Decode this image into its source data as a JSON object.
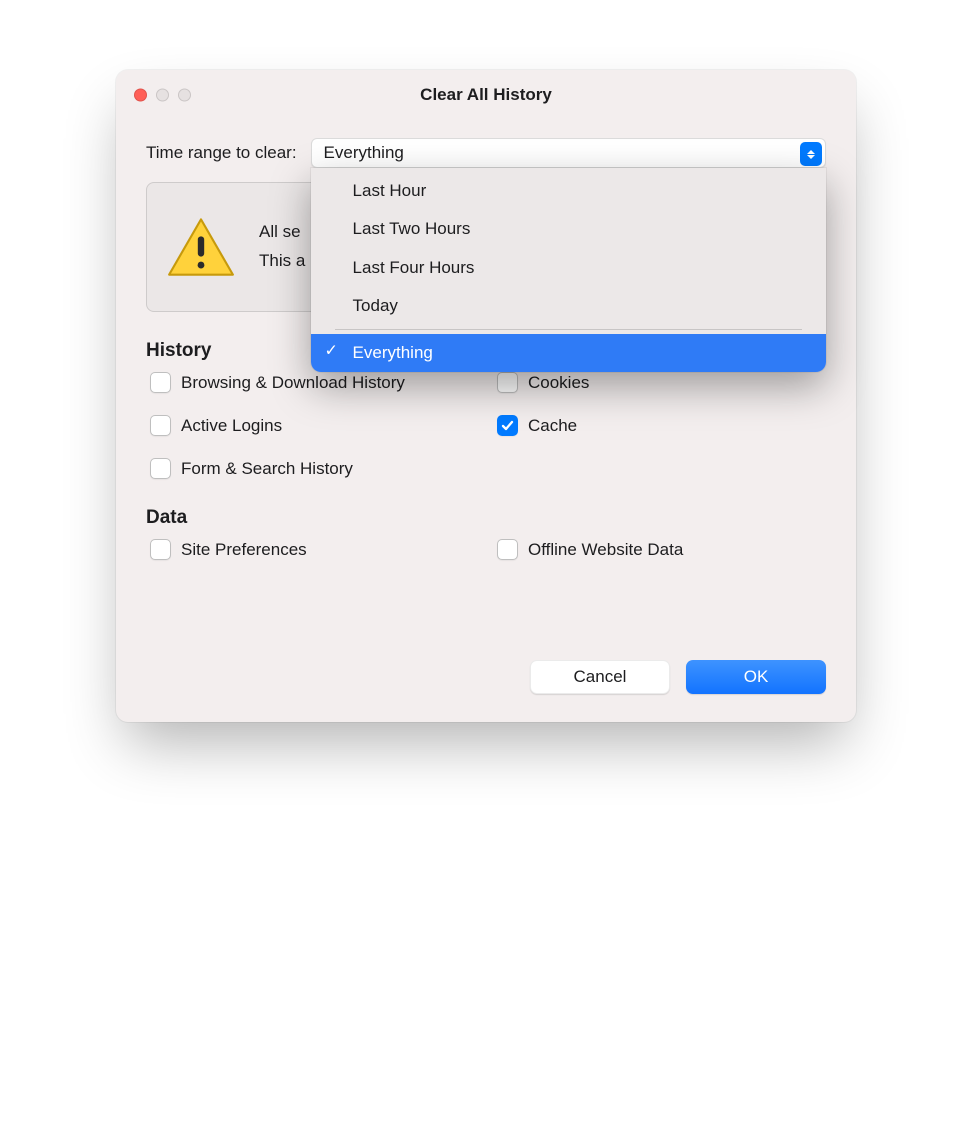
{
  "window": {
    "title": "Clear All History"
  },
  "range": {
    "label": "Time range to clear:",
    "selected": "Everything",
    "options": [
      "Last Hour",
      "Last Two Hours",
      "Last Four Hours",
      "Today"
    ],
    "selected_option": "Everything"
  },
  "warning": {
    "line1": "All se",
    "line2": "This a"
  },
  "sections": {
    "history_title": "History",
    "data_title": "Data"
  },
  "checks": {
    "browsing": {
      "label": "Browsing & Download History",
      "checked": false
    },
    "cookies": {
      "label": "Cookies",
      "checked": false
    },
    "logins": {
      "label": "Active Logins",
      "checked": false
    },
    "cache": {
      "label": "Cache",
      "checked": true
    },
    "form": {
      "label": "Form & Search History",
      "checked": false
    },
    "siteprefs": {
      "label": "Site Preferences",
      "checked": false
    },
    "offline": {
      "label": "Offline Website Data",
      "checked": false
    }
  },
  "buttons": {
    "cancel": "Cancel",
    "ok": "OK"
  }
}
